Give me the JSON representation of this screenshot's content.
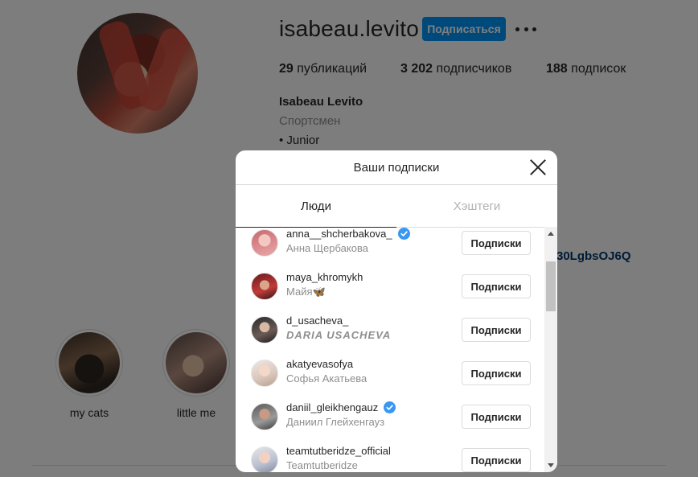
{
  "profile": {
    "username": "isabeau.levito",
    "follow_label": "Подписаться",
    "stats": {
      "posts_count": "29",
      "posts_label": "публикаций",
      "followers_count": "3 202",
      "followers_label": "подписчиков",
      "following_count": "188",
      "following_label": "подписок"
    },
    "full_name": "Isabeau Levito",
    "category": "Спортсмен",
    "bio_line": "• Junior",
    "link_fragment": "30LgbsOJ6Q",
    "highlights": [
      {
        "label": "my cats"
      },
      {
        "label": "little me"
      }
    ]
  },
  "modal": {
    "title": "Ваши подписки",
    "tabs": [
      {
        "label": "Люди",
        "active": true
      },
      {
        "label": "Хэштеги",
        "active": false
      }
    ],
    "following": [
      {
        "username": "anna__shcherbakova_",
        "name": "Анна Щербакова",
        "verified": true,
        "button": "Подписки"
      },
      {
        "username": "maya_khromykh",
        "name": "Майя🦋",
        "verified": false,
        "button": "Подписки"
      },
      {
        "username": "d_usacheva_",
        "name": "DARIA USACHEVA",
        "verified": false,
        "button": "Подписки"
      },
      {
        "username": "akatyevasofya",
        "name": "Софья Акатьева",
        "verified": false,
        "button": "Подписки"
      },
      {
        "username": "daniil_gleikhengauz",
        "name": "Даниил Глейхенгауз",
        "verified": true,
        "button": "Подписки"
      },
      {
        "username": "teamtutberidze_official",
        "name": "Teamtutberidze",
        "verified": false,
        "button": "Подписки"
      }
    ]
  },
  "colors": {
    "accent": "#0095f6",
    "verified": "#3897f0",
    "link": "#00376b",
    "muted": "#8e8e8e"
  }
}
